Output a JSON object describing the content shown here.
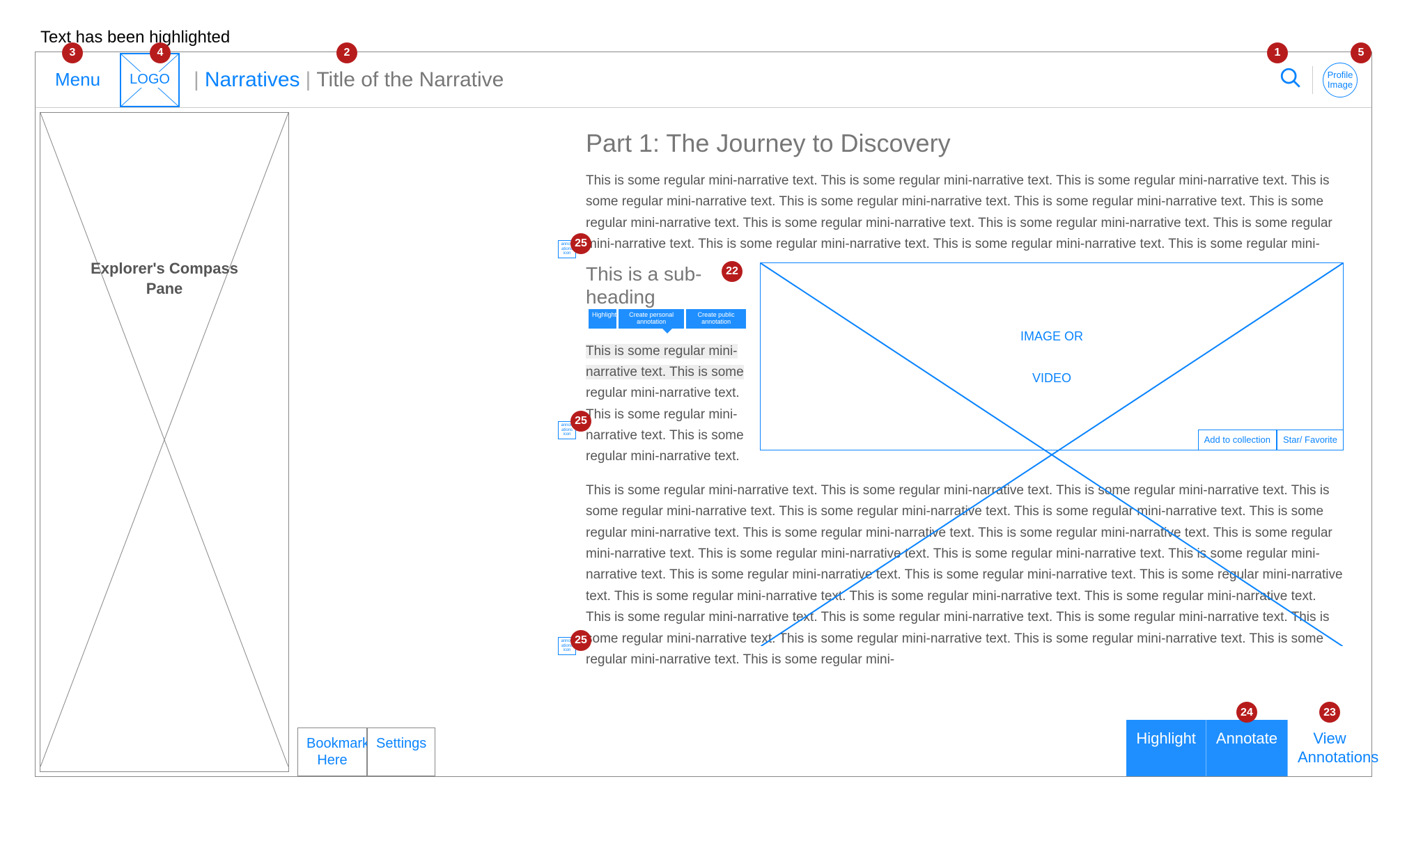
{
  "caption": "Text has been highlighted",
  "topbar": {
    "menu": "Menu",
    "logo": "LOGO",
    "narratives_label": "Narratives",
    "title": "Title of the Narrative",
    "sep": "|",
    "profile": "Profile Image"
  },
  "sidebar": {
    "label": "Explorer's Compass\nPane"
  },
  "content": {
    "part_heading": "Part 1: The Journey to Discovery",
    "para1": "This is some regular mini-narrative text. This is some regular mini-narrative text. This is some regular mini-narrative text. This is some regular mini-narrative text. This is some regular mini-narrative text. This is some regular mini-narrative text. This is some regular mini-narrative text. This is some regular mini-narrative text. This is some regular mini-narrative text. This is some regular mini-narrative text. This is some regular mini-narrative text. This is some regular mini-narrative text. This is some regular mini-",
    "sub_heading": "This is a sub-heading",
    "highlighted": "This is some regular mini-narrative text. This is some",
    "col_rest": " regular mini-narrative text. This is some regular mini-narrative text. This is some regular mini-narrative text.",
    "para3": "This is some regular mini-narrative text. This is some regular mini-narrative text. This is some regular mini-narrative text. This is some regular mini-narrative text. This is some regular mini-narrative text. This is some regular mini-narrative text. This is some regular mini-narrative text. This is some regular mini-narrative text. This is some regular mini-narrative text. This is some regular mini-narrative text. This is some regular mini-narrative text. This is some regular mini-narrative text. This is some regular mini-narrative text. This is some regular mini-narrative text. This is some regular mini-narrative text. This is some regular mini-narrative text. This is some regular mini-narrative text. This is some regular mini-narrative text. This is some regular mini-narrative text. This is some regular mini-narrative text. This is some regular mini-narrative text. This is some regular mini-narrative text. This is some regular mini-narrative text. This is some regular mini-narrative text. This is some regular mini-narrative text. This is some regular mini-narrative text. This is some regular mini-"
  },
  "popover": {
    "highlight": "Highlight",
    "personal": "Create personal annotation",
    "public": "Create public annotation"
  },
  "media": {
    "line1": "IMAGE OR",
    "line2": "VIDEO",
    "add": "Add to collection",
    "star": "Star/ Favorite"
  },
  "bottom_left": {
    "bookmark": "Bookmark Here",
    "settings": "Settings"
  },
  "bottom_right": {
    "highlight": "Highlight",
    "annotate": "Annotate",
    "view": "View Annotations"
  },
  "annot_icon": "annot-\nations\nicon",
  "badges": {
    "b1": "1",
    "b2": "2",
    "b3": "3",
    "b4": "4",
    "b5": "5",
    "b22": "22",
    "b23": "23",
    "b24": "24",
    "b25": "25"
  }
}
